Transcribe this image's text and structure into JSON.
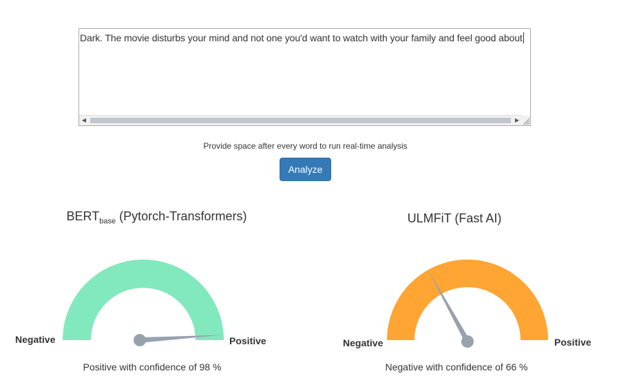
{
  "input": {
    "text": "Dark. The movie disturbs your mind and not one you'd want to watch with your family and feel good about"
  },
  "hint": "Provide space after every word to run real-time analysis",
  "analyze_button": "Analyze",
  "models": [
    {
      "name": "BERT",
      "name_sub": "base",
      "name_suffix": " (Pytorch-Transformers)",
      "gauge_color": "#82e8be",
      "needle_fraction": 0.98,
      "left_label": "Negative",
      "right_label": "Positive",
      "result": "Positive with confidence of 98 %"
    },
    {
      "name": "ULMFiT (Fast AI)",
      "gauge_color": "#ffa533",
      "needle_fraction": 0.34,
      "left_label": "Negative",
      "right_label": "Positive",
      "result": "Negative with confidence of 66 %"
    }
  ],
  "colors": {
    "needle": "#98a2ad",
    "button": "#337ab7"
  }
}
